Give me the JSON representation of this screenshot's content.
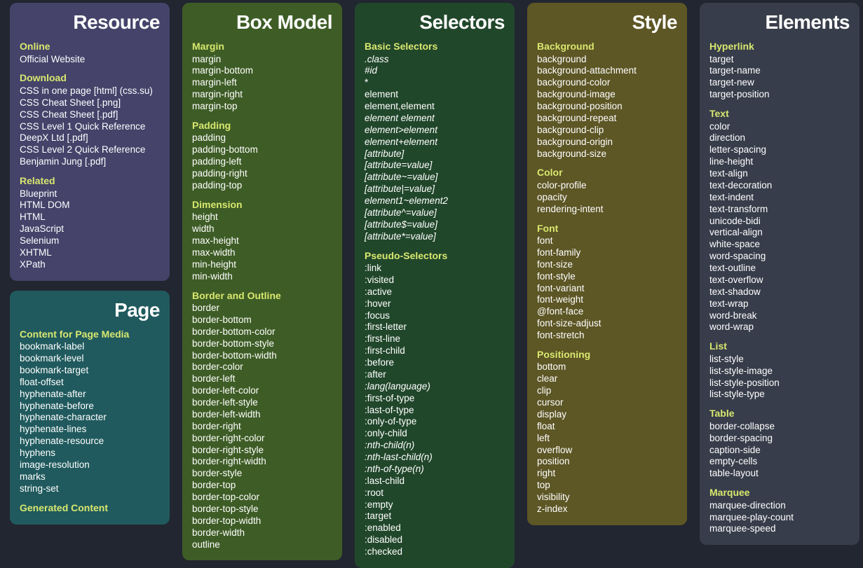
{
  "columns": [
    {
      "cards": [
        {
          "title": "Resource",
          "color": "c-purple",
          "sections": [
            {
              "head": "Online",
              "items": [
                {
                  "t": "Official Website"
                }
              ]
            },
            {
              "head": "Download",
              "items": [
                {
                  "t": "CSS in one page [html] (css.su)"
                },
                {
                  "t": "CSS Cheat Sheet [.png]"
                },
                {
                  "t": "CSS Cheat Sheet [.pdf]"
                },
                {
                  "t": "CSS Level 1 Quick Reference DeepX Ltd [.pdf]"
                },
                {
                  "t": "CSS Level 2 Quick Reference Benjamin Jung [.pdf]"
                }
              ]
            },
            {
              "head": "Related",
              "items": [
                {
                  "t": "Blueprint"
                },
                {
                  "t": "HTML DOM"
                },
                {
                  "t": "HTML"
                },
                {
                  "t": "JavaScript"
                },
                {
                  "t": "Selenium"
                },
                {
                  "t": "XHTML"
                },
                {
                  "t": "XPath"
                }
              ]
            }
          ]
        },
        {
          "title": "Page",
          "color": "c-teal",
          "sections": [
            {
              "head": "Content for Page Media",
              "items": [
                {
                  "t": "bookmark-label"
                },
                {
                  "t": "bookmark-level"
                },
                {
                  "t": "bookmark-target"
                },
                {
                  "t": "float-offset"
                },
                {
                  "t": "hyphenate-after"
                },
                {
                  "t": "hyphenate-before"
                },
                {
                  "t": "hyphenate-character"
                },
                {
                  "t": "hyphenate-lines"
                },
                {
                  "t": "hyphenate-resource"
                },
                {
                  "t": "hyphens"
                },
                {
                  "t": "image-resolution"
                },
                {
                  "t": "marks"
                },
                {
                  "t": "string-set"
                }
              ]
            },
            {
              "head": "Generated Content",
              "items": []
            }
          ]
        }
      ]
    },
    {
      "cards": [
        {
          "title": "Box Model",
          "color": "c-green",
          "sections": [
            {
              "head": "Margin",
              "items": [
                {
                  "t": "margin"
                },
                {
                  "t": "margin-bottom"
                },
                {
                  "t": "margin-left"
                },
                {
                  "t": "margin-right"
                },
                {
                  "t": "margin-top"
                }
              ]
            },
            {
              "head": "Padding",
              "items": [
                {
                  "t": "padding"
                },
                {
                  "t": "padding-bottom"
                },
                {
                  "t": "padding-left"
                },
                {
                  "t": "padding-right"
                },
                {
                  "t": "padding-top"
                }
              ]
            },
            {
              "head": "Dimension",
              "items": [
                {
                  "t": "height"
                },
                {
                  "t": "width"
                },
                {
                  "t": "max-height"
                },
                {
                  "t": "max-width"
                },
                {
                  "t": "min-height"
                },
                {
                  "t": "min-width"
                }
              ]
            },
            {
              "head": "Border and Outline",
              "items": [
                {
                  "t": "border"
                },
                {
                  "t": "border-bottom"
                },
                {
                  "t": "border-bottom-color"
                },
                {
                  "t": "border-bottom-style"
                },
                {
                  "t": "border-bottom-width"
                },
                {
                  "t": "border-color"
                },
                {
                  "t": "border-left"
                },
                {
                  "t": "border-left-color"
                },
                {
                  "t": "border-left-style"
                },
                {
                  "t": "border-left-width"
                },
                {
                  "t": "border-right"
                },
                {
                  "t": "border-right-color"
                },
                {
                  "t": "border-right-style"
                },
                {
                  "t": "border-right-width"
                },
                {
                  "t": "border-style"
                },
                {
                  "t": "border-top"
                },
                {
                  "t": "border-top-color"
                },
                {
                  "t": "border-top-style"
                },
                {
                  "t": "border-top-width"
                },
                {
                  "t": "border-width"
                },
                {
                  "t": "outline"
                }
              ]
            }
          ]
        }
      ]
    },
    {
      "cards": [
        {
          "title": "Selectors",
          "color": "c-darkgreen",
          "sections": [
            {
              "head": "Basic Selectors",
              "items": [
                {
                  "t": ".class",
                  "i": true
                },
                {
                  "t": "#id",
                  "i": true
                },
                {
                  "t": "*"
                },
                {
                  "t": "element"
                },
                {
                  "t": "element,element"
                },
                {
                  "t": "element element",
                  "i": true
                },
                {
                  "t": "element>element",
                  "i": true
                },
                {
                  "t": "element+element",
                  "i": true
                },
                {
                  "t": "[attribute]",
                  "i": true
                },
                {
                  "t": "[attribute=value]",
                  "i": true
                },
                {
                  "t": "[attribute~=value]",
                  "i": true
                },
                {
                  "t": "[attribute|=value]",
                  "i": true
                },
                {
                  "t": "element1~element2",
                  "i": true
                },
                {
                  "t": "[attribute^=value]",
                  "i": true
                },
                {
                  "t": "[attribute$=value]",
                  "i": true
                },
                {
                  "t": "[attribute*=value]",
                  "i": true
                }
              ]
            },
            {
              "head": "Pseudo-Selectors",
              "items": [
                {
                  "t": ":link"
                },
                {
                  "t": ":visited"
                },
                {
                  "t": ":active"
                },
                {
                  "t": ":hover"
                },
                {
                  "t": ":focus"
                },
                {
                  "t": ":first-letter"
                },
                {
                  "t": ":first-line"
                },
                {
                  "t": ":first-child"
                },
                {
                  "t": ":before"
                },
                {
                  "t": ":after"
                },
                {
                  "t": ":lang(language)",
                  "i": true
                },
                {
                  "t": ":first-of-type"
                },
                {
                  "t": ":last-of-type"
                },
                {
                  "t": ":only-of-type"
                },
                {
                  "t": ":only-child"
                },
                {
                  "t": ":nth-child(n)",
                  "i": true
                },
                {
                  "t": ":nth-last-child(n)",
                  "i": true
                },
                {
                  "t": ":nth-of-type(n)",
                  "i": true
                },
                {
                  "t": ":last-child"
                },
                {
                  "t": ":root"
                },
                {
                  "t": ":empty"
                },
                {
                  "t": ":target"
                },
                {
                  "t": ":enabled"
                },
                {
                  "t": ":disabled"
                },
                {
                  "t": ":checked"
                }
              ]
            }
          ]
        }
      ]
    },
    {
      "cards": [
        {
          "title": "Style",
          "color": "c-olive",
          "sections": [
            {
              "head": "Background",
              "items": [
                {
                  "t": "background"
                },
                {
                  "t": "background-attachment"
                },
                {
                  "t": "background-color"
                },
                {
                  "t": "background-image"
                },
                {
                  "t": "background-position"
                },
                {
                  "t": "background-repeat"
                },
                {
                  "t": "background-clip"
                },
                {
                  "t": "background-origin"
                },
                {
                  "t": "background-size"
                }
              ]
            },
            {
              "head": "Color",
              "items": [
                {
                  "t": "color-profile"
                },
                {
                  "t": "opacity"
                },
                {
                  "t": "rendering-intent"
                }
              ]
            },
            {
              "head": "Font",
              "items": [
                {
                  "t": "font"
                },
                {
                  "t": "font-family"
                },
                {
                  "t": "font-size"
                },
                {
                  "t": "font-style"
                },
                {
                  "t": "font-variant"
                },
                {
                  "t": "font-weight"
                },
                {
                  "t": "@font-face"
                },
                {
                  "t": "font-size-adjust"
                },
                {
                  "t": "font-stretch"
                }
              ]
            },
            {
              "head": "Positioning",
              "items": [
                {
                  "t": "bottom"
                },
                {
                  "t": "clear"
                },
                {
                  "t": "clip"
                },
                {
                  "t": "cursor"
                },
                {
                  "t": "display"
                },
                {
                  "t": "float"
                },
                {
                  "t": "left"
                },
                {
                  "t": "overflow"
                },
                {
                  "t": "position"
                },
                {
                  "t": "right"
                },
                {
                  "t": "top"
                },
                {
                  "t": "visibility"
                },
                {
                  "t": "z-index"
                }
              ]
            }
          ]
        }
      ]
    },
    {
      "cards": [
        {
          "title": "Elements",
          "color": "c-slate",
          "sections": [
            {
              "head": "Hyperlink",
              "items": [
                {
                  "t": "target"
                },
                {
                  "t": "target-name"
                },
                {
                  "t": "target-new"
                },
                {
                  "t": "target-position"
                }
              ]
            },
            {
              "head": "Text",
              "items": [
                {
                  "t": "color"
                },
                {
                  "t": "direction"
                },
                {
                  "t": "letter-spacing"
                },
                {
                  "t": "line-height"
                },
                {
                  "t": "text-align"
                },
                {
                  "t": "text-decoration"
                },
                {
                  "t": "text-indent"
                },
                {
                  "t": "text-transform"
                },
                {
                  "t": "unicode-bidi"
                },
                {
                  "t": "vertical-align"
                },
                {
                  "t": "white-space"
                },
                {
                  "t": "word-spacing"
                },
                {
                  "t": "text-outline"
                },
                {
                  "t": "text-overflow"
                },
                {
                  "t": "text-shadow"
                },
                {
                  "t": "text-wrap"
                },
                {
                  "t": "word-break"
                },
                {
                  "t": "word-wrap"
                }
              ]
            },
            {
              "head": "List",
              "items": [
                {
                  "t": "list-style"
                },
                {
                  "t": "list-style-image"
                },
                {
                  "t": "list-style-position"
                },
                {
                  "t": "list-style-type"
                }
              ]
            },
            {
              "head": "Table",
              "items": [
                {
                  "t": "border-collapse"
                },
                {
                  "t": "border-spacing"
                },
                {
                  "t": "caption-side"
                },
                {
                  "t": "empty-cells"
                },
                {
                  "t": "table-layout"
                }
              ]
            },
            {
              "head": "Marquee",
              "items": [
                {
                  "t": "marquee-direction"
                },
                {
                  "t": "marquee-play-count"
                },
                {
                  "t": "marquee-speed"
                }
              ]
            }
          ]
        }
      ]
    }
  ]
}
